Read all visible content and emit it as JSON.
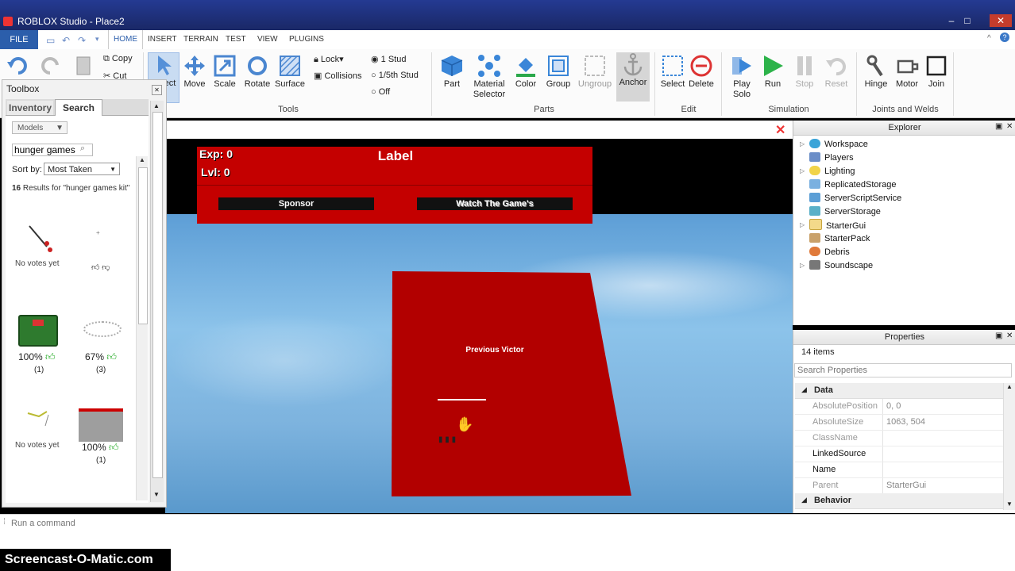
{
  "window": {
    "title": "ROBLOX Studio - Place2"
  },
  "ribbon_tabs": [
    "FILE",
    "HOME",
    "INSERT",
    "TERRAIN",
    "TEST",
    "VIEW",
    "PLUGINS"
  ],
  "ribbon": {
    "clipboard": {
      "copy": "Copy",
      "cut": "Cut"
    },
    "tools": {
      "select": "Select",
      "move": "Move",
      "scale": "Scale",
      "rotate": "Rotate",
      "surface": "Surface",
      "lock": "Lock",
      "collisions": "Collisions",
      "group_label": "Tools"
    },
    "snap": {
      "one_stud": "1 Stud",
      "fifth_stud": "1/5th Stud",
      "off": "Off"
    },
    "parts": {
      "part": "Part",
      "material": "Material Selector",
      "color": "Color",
      "group": "Group",
      "ungroup": "Ungroup",
      "anchor": "Anchor",
      "group_label": "Parts"
    },
    "edit": {
      "select": "Select",
      "delete": "Delete",
      "group_label": "Edit"
    },
    "simulation": {
      "play_solo": "Play Solo",
      "run": "Run",
      "stop": "Stop",
      "reset": "Reset",
      "group_label": "Simulation"
    },
    "joints": {
      "hinge": "Hinge",
      "motor": "Motor",
      "join": "Join",
      "group_label": "Joints and Welds"
    }
  },
  "toolbox": {
    "title": "Toolbox",
    "tabs": {
      "inventory": "Inventory",
      "search": "Search"
    },
    "category": "Models",
    "search_value": "hunger games",
    "sort_label": "Sort by:",
    "sort_value": "Most Taken",
    "results_count": "16",
    "results_text": "Results for \"hunger games kit\"",
    "items": [
      {
        "rating": "No votes yet",
        "votes": ""
      },
      {
        "rating": "",
        "votes": ""
      },
      {
        "rating": "100%",
        "votes": "(1)"
      },
      {
        "rating": "67%",
        "votes": "(3)"
      },
      {
        "rating": "No votes yet",
        "votes": ""
      },
      {
        "rating": "100%",
        "votes": "(1)"
      }
    ]
  },
  "gui": {
    "exp": "Exp: 0",
    "lvl": "Lvl: 0",
    "label": "Label",
    "sponsor": "Sponsor",
    "watch": "Watch The Game's",
    "previous_victor": "Previous Victor"
  },
  "explorer": {
    "title": "Explorer",
    "items": [
      "Workspace",
      "Players",
      "Lighting",
      "ReplicatedStorage",
      "ServerScriptService",
      "ServerStorage",
      "StarterGui",
      "StarterPack",
      "Debris",
      "Soundscape"
    ]
  },
  "properties": {
    "title": "Properties",
    "count": "14 items",
    "search_placeholder": "Search Properties",
    "section_data": "Data",
    "rows": [
      {
        "key": "AbsolutePosition",
        "value": "0, 0"
      },
      {
        "key": "AbsoluteSize",
        "value": "1063, 504"
      },
      {
        "key": "ClassName",
        "value": ""
      },
      {
        "key": "LinkedSource",
        "value": ""
      },
      {
        "key": "Name",
        "value": ""
      },
      {
        "key": "Parent",
        "value": "StarterGui"
      }
    ],
    "section_behavior": "Behavior"
  },
  "command_bar": {
    "placeholder": "Run a command"
  },
  "watermark": "Screencast-O-Matic.com",
  "colors": {
    "gui_red": "#c40000",
    "ribbon_blue": "#2b5eab",
    "run_green": "#2db34a"
  }
}
